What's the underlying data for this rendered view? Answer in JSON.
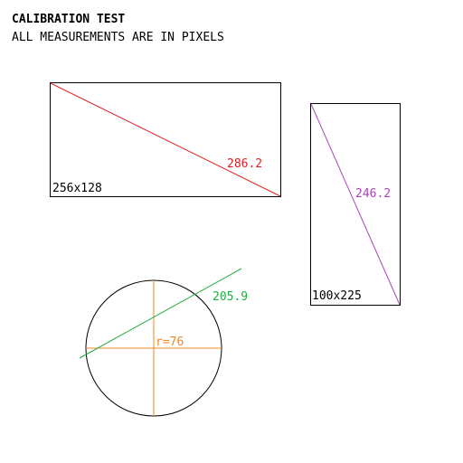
{
  "header": {
    "title": "CALIBRATION TEST",
    "subtitle": "ALL MEASUREMENTS ARE IN PIXELS"
  },
  "figures": {
    "rect_a": {
      "size_label": "256x128",
      "diagonal_label": "286.2",
      "diagonal_color": "#dd2222"
    },
    "rect_b": {
      "size_label": "100x225",
      "diagonal_label": "246.2",
      "diagonal_color": "#aa44bb"
    },
    "circle": {
      "radius_label": "r=76",
      "radius_color": "#ee8822",
      "line_label": "205.9",
      "line_color": "#22aa44"
    }
  },
  "colors": {
    "outline": "#000000",
    "background": "#ffffff"
  }
}
